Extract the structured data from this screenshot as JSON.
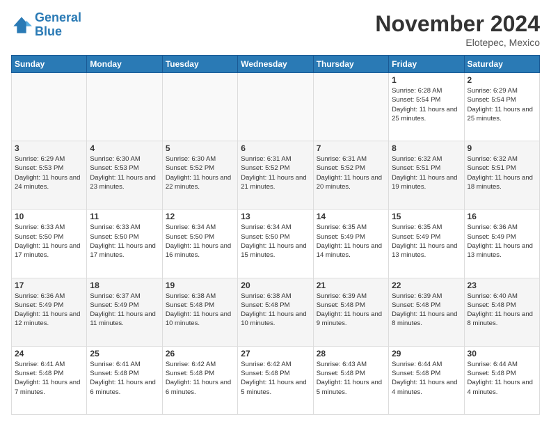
{
  "header": {
    "logo_line1": "General",
    "logo_line2": "Blue",
    "month_title": "November 2024",
    "subtitle": "Elotepec, Mexico"
  },
  "days_of_week": [
    "Sunday",
    "Monday",
    "Tuesday",
    "Wednesday",
    "Thursday",
    "Friday",
    "Saturday"
  ],
  "weeks": [
    [
      {
        "day": "",
        "info": ""
      },
      {
        "day": "",
        "info": ""
      },
      {
        "day": "",
        "info": ""
      },
      {
        "day": "",
        "info": ""
      },
      {
        "day": "",
        "info": ""
      },
      {
        "day": "1",
        "info": "Sunrise: 6:28 AM\nSunset: 5:54 PM\nDaylight: 11 hours\nand 25 minutes."
      },
      {
        "day": "2",
        "info": "Sunrise: 6:29 AM\nSunset: 5:54 PM\nDaylight: 11 hours\nand 25 minutes."
      }
    ],
    [
      {
        "day": "3",
        "info": "Sunrise: 6:29 AM\nSunset: 5:53 PM\nDaylight: 11 hours\nand 24 minutes."
      },
      {
        "day": "4",
        "info": "Sunrise: 6:30 AM\nSunset: 5:53 PM\nDaylight: 11 hours\nand 23 minutes."
      },
      {
        "day": "5",
        "info": "Sunrise: 6:30 AM\nSunset: 5:52 PM\nDaylight: 11 hours\nand 22 minutes."
      },
      {
        "day": "6",
        "info": "Sunrise: 6:31 AM\nSunset: 5:52 PM\nDaylight: 11 hours\nand 21 minutes."
      },
      {
        "day": "7",
        "info": "Sunrise: 6:31 AM\nSunset: 5:52 PM\nDaylight: 11 hours\nand 20 minutes."
      },
      {
        "day": "8",
        "info": "Sunrise: 6:32 AM\nSunset: 5:51 PM\nDaylight: 11 hours\nand 19 minutes."
      },
      {
        "day": "9",
        "info": "Sunrise: 6:32 AM\nSunset: 5:51 PM\nDaylight: 11 hours\nand 18 minutes."
      }
    ],
    [
      {
        "day": "10",
        "info": "Sunrise: 6:33 AM\nSunset: 5:50 PM\nDaylight: 11 hours\nand 17 minutes."
      },
      {
        "day": "11",
        "info": "Sunrise: 6:33 AM\nSunset: 5:50 PM\nDaylight: 11 hours\nand 17 minutes."
      },
      {
        "day": "12",
        "info": "Sunrise: 6:34 AM\nSunset: 5:50 PM\nDaylight: 11 hours\nand 16 minutes."
      },
      {
        "day": "13",
        "info": "Sunrise: 6:34 AM\nSunset: 5:50 PM\nDaylight: 11 hours\nand 15 minutes."
      },
      {
        "day": "14",
        "info": "Sunrise: 6:35 AM\nSunset: 5:49 PM\nDaylight: 11 hours\nand 14 minutes."
      },
      {
        "day": "15",
        "info": "Sunrise: 6:35 AM\nSunset: 5:49 PM\nDaylight: 11 hours\nand 13 minutes."
      },
      {
        "day": "16",
        "info": "Sunrise: 6:36 AM\nSunset: 5:49 PM\nDaylight: 11 hours\nand 13 minutes."
      }
    ],
    [
      {
        "day": "17",
        "info": "Sunrise: 6:36 AM\nSunset: 5:49 PM\nDaylight: 11 hours\nand 12 minutes."
      },
      {
        "day": "18",
        "info": "Sunrise: 6:37 AM\nSunset: 5:49 PM\nDaylight: 11 hours\nand 11 minutes."
      },
      {
        "day": "19",
        "info": "Sunrise: 6:38 AM\nSunset: 5:48 PM\nDaylight: 11 hours\nand 10 minutes."
      },
      {
        "day": "20",
        "info": "Sunrise: 6:38 AM\nSunset: 5:48 PM\nDaylight: 11 hours\nand 10 minutes."
      },
      {
        "day": "21",
        "info": "Sunrise: 6:39 AM\nSunset: 5:48 PM\nDaylight: 11 hours\nand 9 minutes."
      },
      {
        "day": "22",
        "info": "Sunrise: 6:39 AM\nSunset: 5:48 PM\nDaylight: 11 hours\nand 8 minutes."
      },
      {
        "day": "23",
        "info": "Sunrise: 6:40 AM\nSunset: 5:48 PM\nDaylight: 11 hours\nand 8 minutes."
      }
    ],
    [
      {
        "day": "24",
        "info": "Sunrise: 6:41 AM\nSunset: 5:48 PM\nDaylight: 11 hours\nand 7 minutes."
      },
      {
        "day": "25",
        "info": "Sunrise: 6:41 AM\nSunset: 5:48 PM\nDaylight: 11 hours\nand 6 minutes."
      },
      {
        "day": "26",
        "info": "Sunrise: 6:42 AM\nSunset: 5:48 PM\nDaylight: 11 hours\nand 6 minutes."
      },
      {
        "day": "27",
        "info": "Sunrise: 6:42 AM\nSunset: 5:48 PM\nDaylight: 11 hours\nand 5 minutes."
      },
      {
        "day": "28",
        "info": "Sunrise: 6:43 AM\nSunset: 5:48 PM\nDaylight: 11 hours\nand 5 minutes."
      },
      {
        "day": "29",
        "info": "Sunrise: 6:44 AM\nSunset: 5:48 PM\nDaylight: 11 hours\nand 4 minutes."
      },
      {
        "day": "30",
        "info": "Sunrise: 6:44 AM\nSunset: 5:48 PM\nDaylight: 11 hours\nand 4 minutes."
      }
    ]
  ]
}
